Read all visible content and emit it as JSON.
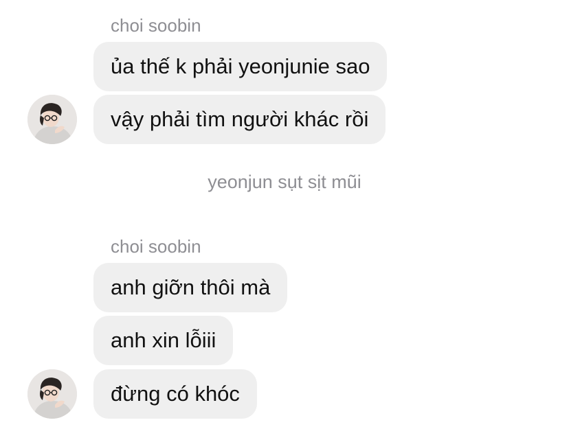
{
  "chat": {
    "group1": {
      "sender": "choi soobin",
      "messages": [
        "ủa thế k phải yeonjunie sao",
        "vậy phải tìm người khác rồi"
      ]
    },
    "system_note": "yeonjun sụt sịt mũi",
    "group2": {
      "sender": "choi soobin",
      "messages": [
        "anh giỡn thôi mà",
        "anh xin lỗiii",
        "đừng có khóc"
      ]
    }
  },
  "colors": {
    "bubble_bg": "#efefef",
    "sender_text": "#8e8e93",
    "message_text": "#111111",
    "background": "#ffffff"
  },
  "icons": {
    "avatar": "profile-photo-avatar"
  }
}
